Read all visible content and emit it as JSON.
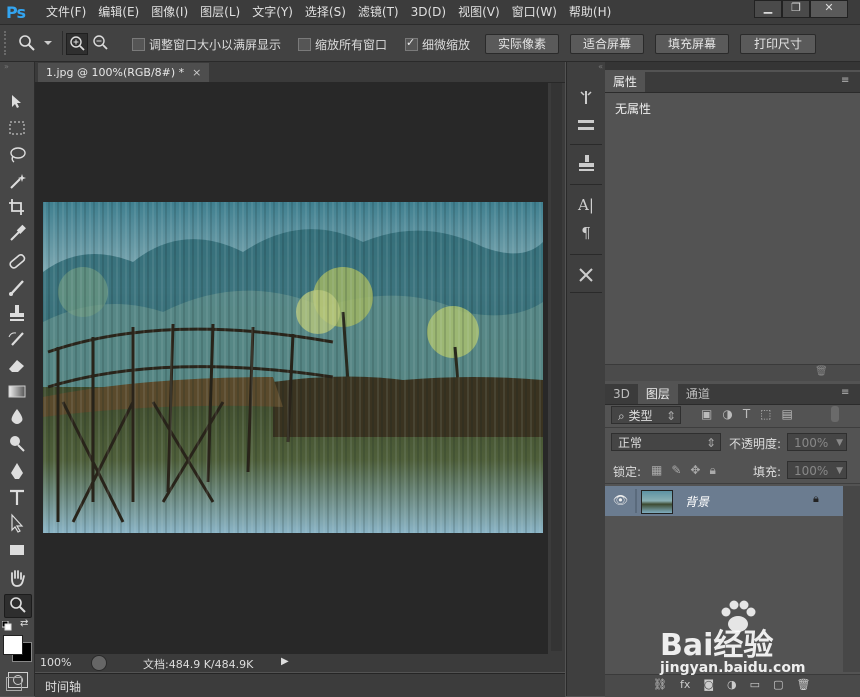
{
  "app": {
    "logo": "Ps"
  },
  "menu": [
    "文件(F)",
    "编辑(E)",
    "图像(I)",
    "图层(L)",
    "文字(Y)",
    "选择(S)",
    "滤镜(T)",
    "3D(D)",
    "视图(V)",
    "窗口(W)",
    "帮助(H)"
  ],
  "window_controls": {
    "minimize": "▁",
    "restore": "❐",
    "close": "✕"
  },
  "options": {
    "resize_windows": "调整窗口大小以满屏显示",
    "zoom_all": "缩放所有窗口",
    "scrubby_zoom": "细微缩放",
    "scrubby_checked": true,
    "btn_actual": "实际像素",
    "btn_fit": "适合屏幕",
    "btn_fill": "填充屏幕",
    "btn_print": "打印尺寸"
  },
  "document": {
    "tab_title": "1.jpg @ 100%(RGB/8#) *",
    "close": "×",
    "zoom": "100%",
    "doc_info": "文档:484.9 K/484.9K",
    "play": "▶"
  },
  "timeline": {
    "label": "时间轴"
  },
  "properties": {
    "tab": "属性",
    "content": "无属性"
  },
  "layers": {
    "tabs": [
      "3D",
      "图层",
      "通道"
    ],
    "active_tab": 1,
    "filter_kind": "类型",
    "blend_mode": "正常",
    "opacity_label": "不透明度:",
    "opacity_value": "100%",
    "lock_label": "锁定:",
    "fill_label": "填充:",
    "fill_value": "100%",
    "layer_name": "背景"
  },
  "watermark": {
    "brand": "Bai经验",
    "url": "jingyan.baidu.com"
  },
  "icons": {
    "accent": "#33a4f0"
  }
}
